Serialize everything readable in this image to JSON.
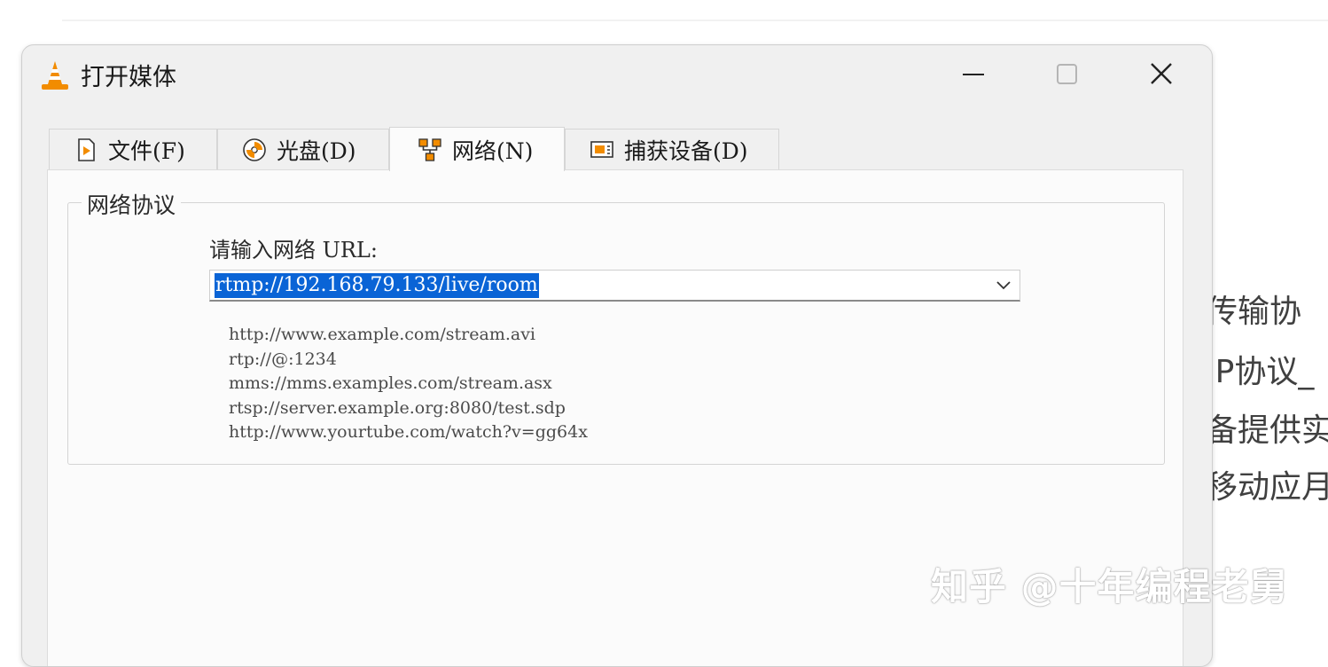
{
  "dialog": {
    "title": "打开媒体",
    "tabs": [
      {
        "label": "文件(F)",
        "icon": "file-play-icon"
      },
      {
        "label": "光盘(D)",
        "icon": "disc-icon"
      },
      {
        "label": "网络(N)",
        "icon": "network-icon",
        "selected": true
      },
      {
        "label": "捕获设备(D)",
        "icon": "capture-device-icon"
      }
    ],
    "group_title": "网络协议",
    "url_prompt": "请输入网络 URL:",
    "url_value": "rtmp://192.168.79.133/live/room",
    "examples": [
      "http://www.example.com/stream.avi",
      "rtp://@:1234",
      "mms://mms.examples.com/stream.asx",
      "rtsp://server.example.org:8080/test.sdp",
      "http://www.yourtube.com/watch?v=gg64x"
    ]
  },
  "background_text": [
    "传输协",
    "IP协议_",
    "备提供实",
    "移动应月"
  ],
  "watermark": "知乎 @十年编程老舅",
  "colors": {
    "selection": "#0a64d6",
    "vlc_orange": "#f28c00",
    "dialog_bg": "#f0f0f0"
  }
}
